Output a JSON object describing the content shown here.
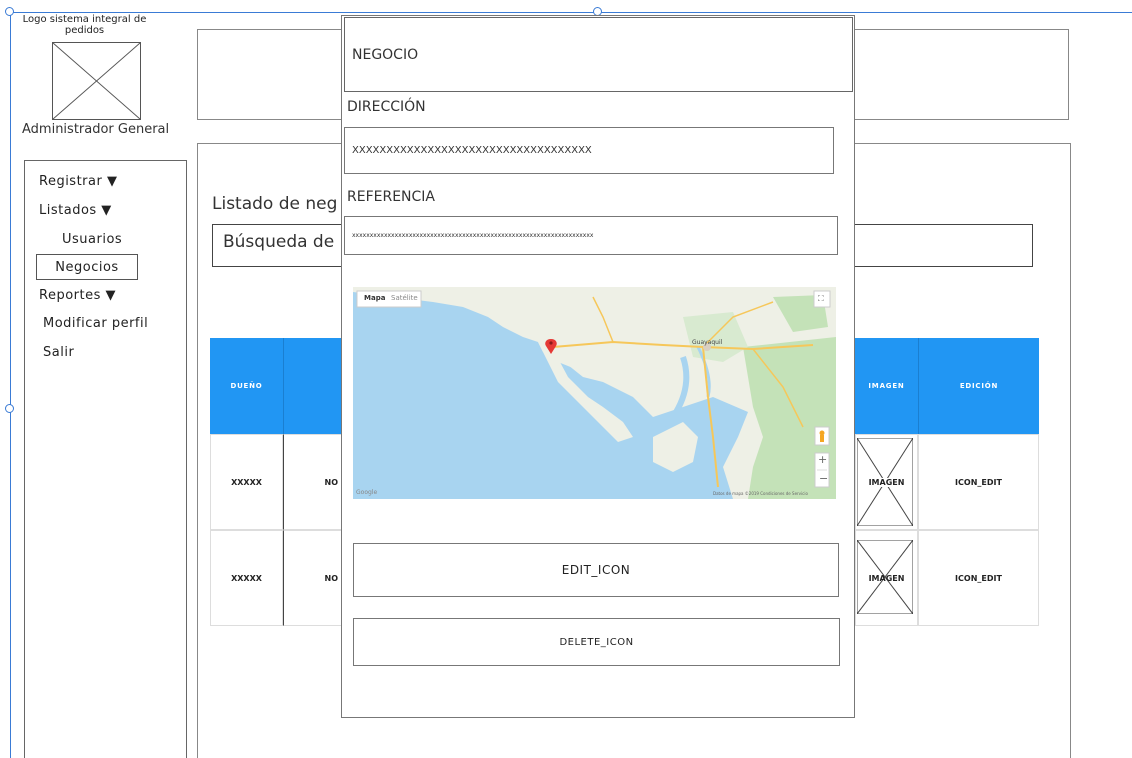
{
  "app": {
    "logo_text": "Logo sistema integral de pedidos",
    "user_role": "Administrador General"
  },
  "sidebar": {
    "items": [
      {
        "label": "Registrar ▼"
      },
      {
        "label": "Listados ▼"
      },
      {
        "label": "Usuarios"
      },
      {
        "label": "Negocios"
      },
      {
        "label": "Reportes ▼"
      },
      {
        "label": "Modificar perfil"
      },
      {
        "label": "Salir"
      }
    ]
  },
  "main": {
    "title": "Listado de neg",
    "search_value": "Búsqueda de r",
    "table": {
      "headers": [
        "DUEÑO",
        "IMAGEN",
        "EDICIÓN"
      ],
      "rows": [
        {
          "owner": "XXXXX",
          "name": "NO",
          "image": "IMAGEN",
          "edit": "ICON_EDIT"
        },
        {
          "owner": "XXXXX",
          "name": "NO",
          "image": "IMAGEN",
          "edit": "ICON_EDIT"
        }
      ]
    }
  },
  "modal": {
    "title_field": "NEGOCIO",
    "address_label": "DIRECCIÓN",
    "address_value": "XXXXXXXXXXXXXXXXXXXXXXXXXXXXXXXXXXX",
    "reference_label": "REFERENCIA",
    "reference_value": "xxxxxxxxxxxxxxxxxxxxxxxxxxxxxxxxxxxxxxxxxxxxxxxxxxxxxxxxxxxxxxxxxxxx",
    "map": {
      "tab_map": "Mapa",
      "tab_satellite": "Satélite",
      "city_label": "Guayaquil",
      "zoom_in": "+",
      "zoom_out": "−",
      "attribution": "Google",
      "terms": "Datos de mapa ©2019   Condiciones de Servicio",
      "colors": {
        "water": "#a8d4f0",
        "land": "#eef0e6",
        "park": "#c4e2b8",
        "road": "#f6c75a",
        "pin": "#e53935"
      }
    },
    "edit_button": "EDIT_ICON",
    "delete_button": "DELETE_ICON"
  },
  "colors": {
    "accent": "#2196f3",
    "selection": "#3a7bd5"
  }
}
